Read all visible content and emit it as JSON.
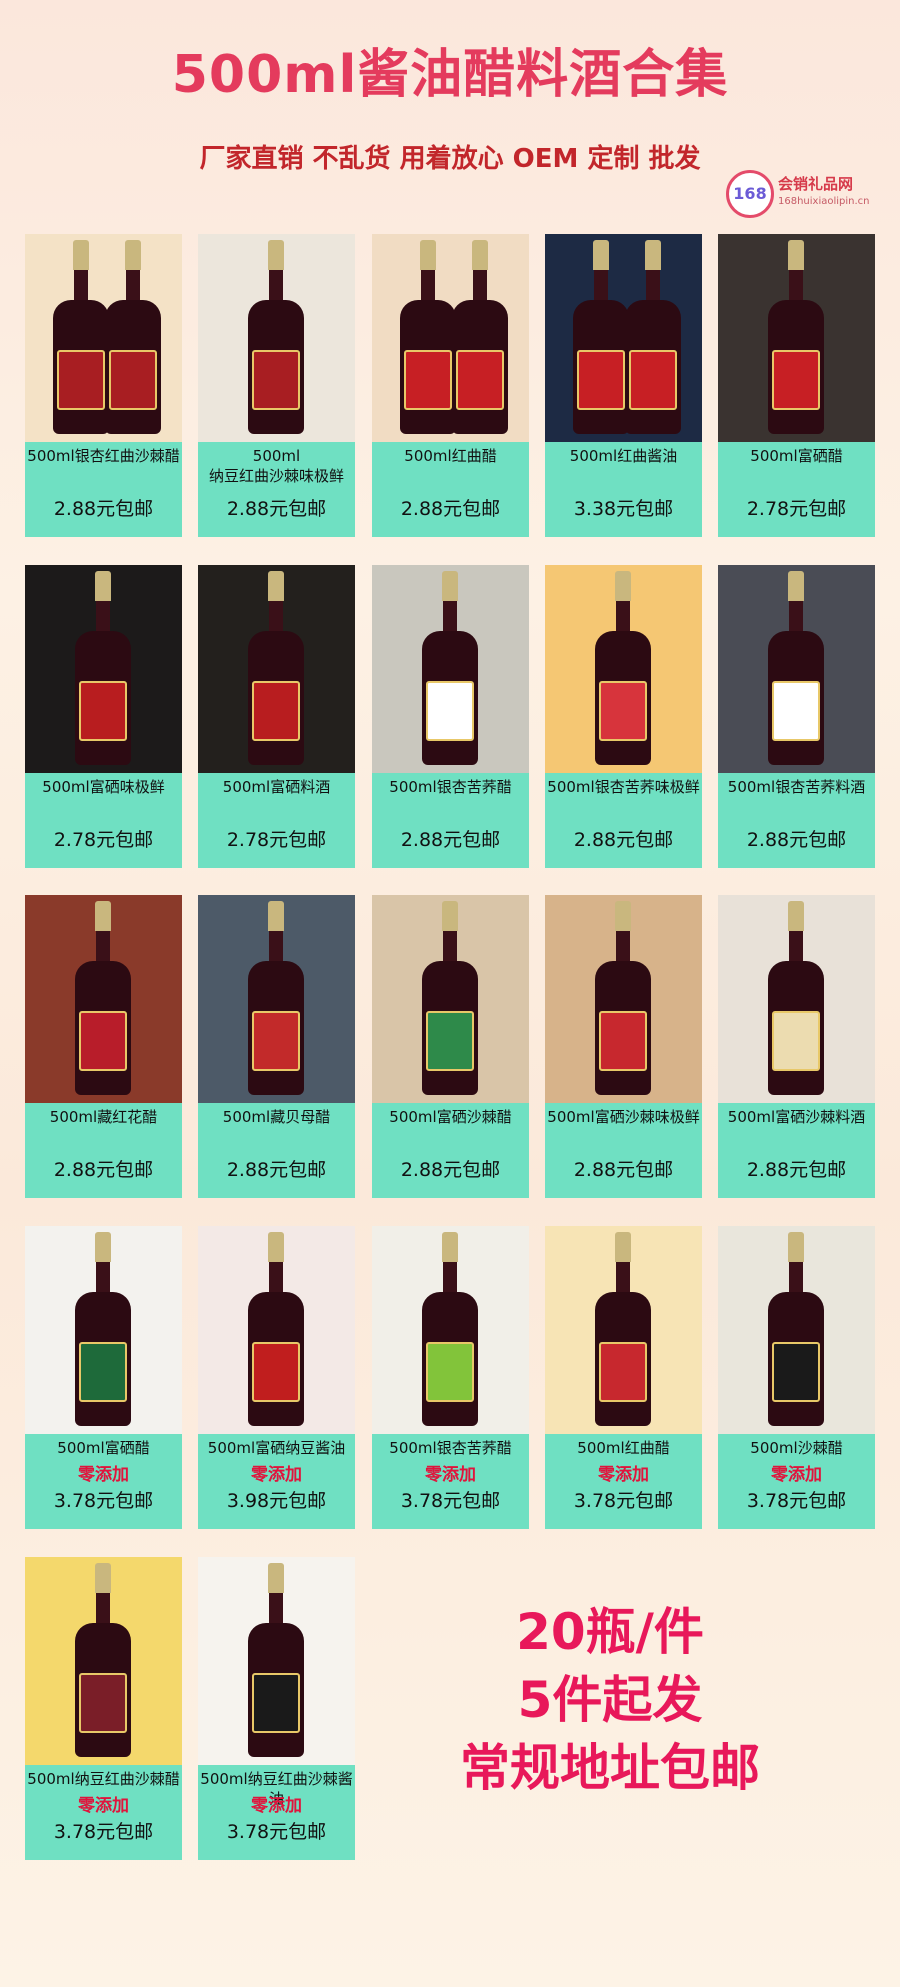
{
  "header": {
    "title": "500ml酱油醋料酒合集",
    "subtitle": "厂家直销 不乱货 用着放心 OEM 定制 批发"
  },
  "logo": {
    "badge": "168",
    "name": "会销礼品网",
    "url": "168huixiaolipin.cn"
  },
  "products": [
    {
      "name": "500ml银杏红曲沙棘醋",
      "price": "2.88元包邮",
      "note": ""
    },
    {
      "name": "500ml\n纳豆红曲沙棘味极鲜",
      "price": "2.88元包邮",
      "note": ""
    },
    {
      "name": "500ml红曲醋",
      "price": "2.88元包邮",
      "note": ""
    },
    {
      "name": "500ml红曲酱油",
      "price": "3.38元包邮",
      "note": ""
    },
    {
      "name": "500ml富硒醋",
      "price": "2.78元包邮",
      "note": ""
    },
    {
      "name": "500ml富硒味极鲜",
      "price": "2.78元包邮",
      "note": ""
    },
    {
      "name": "500ml富硒料酒",
      "price": "2.78元包邮",
      "note": ""
    },
    {
      "name": "500ml银杏苦荞醋",
      "price": "2.88元包邮",
      "note": ""
    },
    {
      "name": "500ml银杏苦荞味极鲜",
      "price": "2.88元包邮",
      "note": ""
    },
    {
      "name": "500ml银杏苦荞料酒",
      "price": "2.88元包邮",
      "note": ""
    },
    {
      "name": "500ml藏红花醋",
      "price": "2.88元包邮",
      "note": ""
    },
    {
      "name": "500ml藏贝母醋",
      "price": "2.88元包邮",
      "note": ""
    },
    {
      "name": "500ml富硒沙棘醋",
      "price": "2.88元包邮",
      "note": ""
    },
    {
      "name": "500ml富硒沙棘味极鲜",
      "price": "2.88元包邮",
      "note": ""
    },
    {
      "name": "500ml富硒沙棘料酒",
      "price": "2.88元包邮",
      "note": ""
    },
    {
      "name": "500ml富硒醋",
      "price": "3.78元包邮",
      "note": "零添加"
    },
    {
      "name": "500ml富硒纳豆酱油",
      "price": "3.98元包邮",
      "note": "零添加"
    },
    {
      "name": "500ml银杏苦荞醋",
      "price": "3.78元包邮",
      "note": "零添加"
    },
    {
      "name": "500ml红曲醋",
      "price": "3.78元包邮",
      "note": "零添加"
    },
    {
      "name": "500ml沙棘醋",
      "price": "3.78元包邮",
      "note": "零添加"
    },
    {
      "name": "500ml纳豆红曲沙棘醋",
      "price": "3.78元包邮",
      "note": "零添加"
    },
    {
      "name": "500ml纳豆红曲沙棘酱油",
      "price": "3.78元包邮",
      "note": "零添加"
    }
  ],
  "promo": {
    "line1": "20瓶/件",
    "line2": "5件起发",
    "line3": "常规地址包邮"
  },
  "theme": {
    "accent": "#e43b5d",
    "card_info_bg": "#6fe0c2",
    "note_color": "#e0143c"
  },
  "photo_themes": [
    {
      "bg": "#f4e2c6",
      "label": "#a81e22",
      "count": 2
    },
    {
      "bg": "#ece6dc",
      "label": "#a81e22",
      "count": 1
    },
    {
      "bg": "#f1dcc3",
      "label": "#c71f24",
      "count": 2
    },
    {
      "bg": "#1d2a44",
      "label": "#c71f24",
      "count": 2
    },
    {
      "bg": "#3a3330",
      "label": "#c71f24",
      "count": 1
    },
    {
      "bg": "#1c1a1a",
      "label": "#b81d1f",
      "count": 1
    },
    {
      "bg": "#23201d",
      "label": "#b81d1f",
      "count": 1
    },
    {
      "bg": "#c9c7be",
      "label": "#ffffff",
      "count": 1
    },
    {
      "bg": "#f5c773",
      "label": "#d7343c",
      "count": 1
    },
    {
      "bg": "#4a4c55",
      "label": "#ffffff",
      "count": 1
    },
    {
      "bg": "#8a3a2a",
      "label": "#b81d2a",
      "count": 1
    },
    {
      "bg": "#4d5a68",
      "label": "#c22a2a",
      "count": 1
    },
    {
      "bg": "#d9c5a8",
      "label": "#2e8a4a",
      "count": 1
    },
    {
      "bg": "#d7b38a",
      "label": "#c7282e",
      "count": 1
    },
    {
      "bg": "#e8e1d8",
      "label": "#ecdcb0",
      "count": 1
    },
    {
      "bg": "#f3f2ee",
      "label": "#1e6a3a",
      "count": 1
    },
    {
      "bg": "#f3e9e6",
      "label": "#c01e1e",
      "count": 1
    },
    {
      "bg": "#f1efe8",
      "label": "#82c43a",
      "count": 1
    },
    {
      "bg": "#f7e4b5",
      "label": "#c7282e",
      "count": 1
    },
    {
      "bg": "#e9e6dc",
      "label": "#1a1a1a",
      "count": 1
    },
    {
      "bg": "#f4d86c",
      "label": "#7a1e28",
      "count": 1
    },
    {
      "bg": "#f6f3ee",
      "label": "#1a1a1a",
      "count": 1
    }
  ]
}
